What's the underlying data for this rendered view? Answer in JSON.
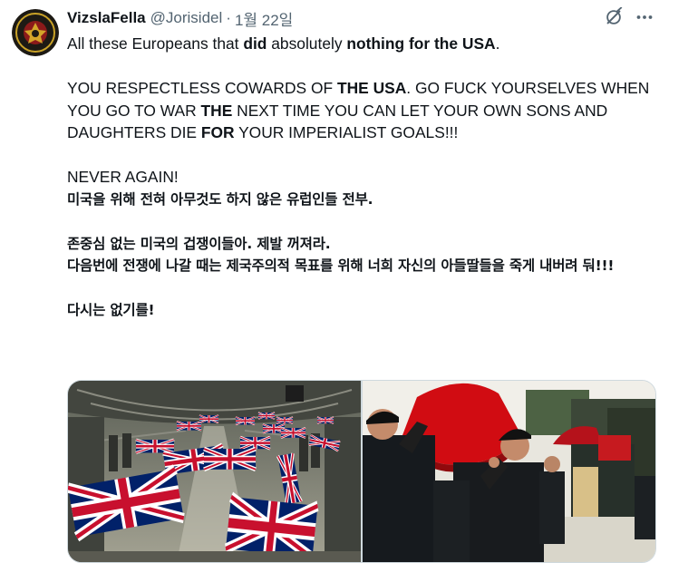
{
  "author": {
    "display_name": "VizslaFella",
    "handle": "@Jorisidel",
    "separator": "·",
    "date": "1월 22일",
    "avatar_text_top": "ALLION LEGION",
    "avatar_text_bottom": "VIZSLAFELLA"
  },
  "icons": {
    "grok": "grok-icon",
    "more": "more-icon"
  },
  "tweet": {
    "p1": {
      "t1": "All these Europeans that ",
      "b1": "did",
      "t2": " absolutely ",
      "b2": "nothing for the USA",
      "t3": "."
    },
    "p2": {
      "t1": "YOU RESPECTLESS COWARDS OF ",
      "b1": "THE USA",
      "t2": ". GO FUCK YOURSELVES WHEN YOU GO TO WAR ",
      "b2": "THE",
      "t3": " NEXT TIME YOU CAN LET YOUR OWN SONS AND DAUGHTERS DIE ",
      "b3": "FOR",
      "t4": " YOUR IMPERIALIST GOALS!!!"
    },
    "p3": "NEVER AGAIN!",
    "kr1": "미국을 위해 전혀 아무것도 하지 않은 유럽인들 전부.",
    "kr2": "존중심 없는 미국의 겁쟁이들아. 제발 꺼져라.",
    "kr3": "다음번에 전쟁에 나갈 때는 제국주의적 목표를 위해 너희 자신의 아들딸들을 죽게 내버려 둬!!!",
    "kr4": "다시는 없기를!"
  },
  "media": {
    "image1": "flag-draped coffins in aircraft hold",
    "image2": "soldiers carrying flag-draped coffin"
  },
  "colors": {
    "text": "#0f1419",
    "secondary": "#536471",
    "border": "#cfd9de",
    "union_blue": "#012169",
    "union_red": "#C8102E"
  }
}
